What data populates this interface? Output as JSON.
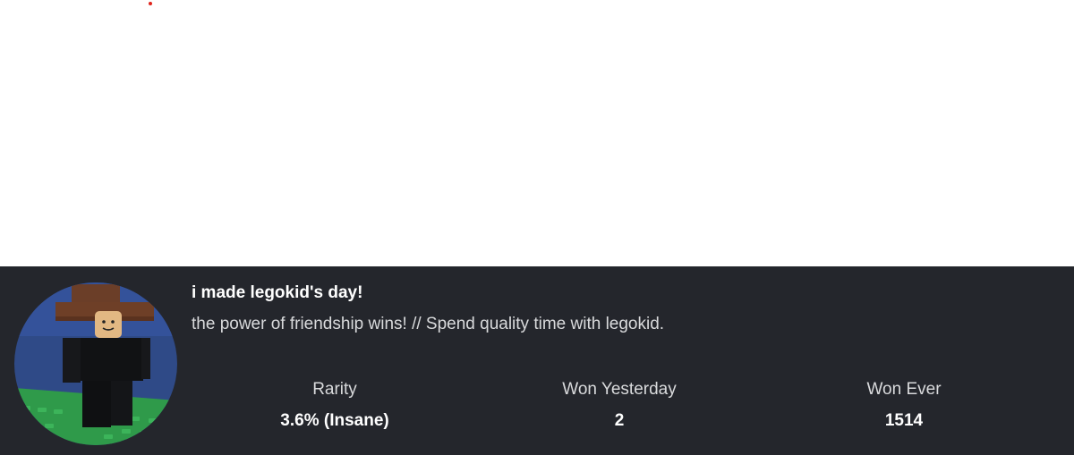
{
  "badge": {
    "title": "i made legokid's day!",
    "description": "the power of friendship wins! // Spend quality time with legokid."
  },
  "stats": {
    "rarity": {
      "label": "Rarity",
      "value": "3.6% (Insane)"
    },
    "won_yesterday": {
      "label": "Won Yesterday",
      "value": "2"
    },
    "won_ever": {
      "label": "Won Ever",
      "value": "1514"
    }
  },
  "colors": {
    "panel_background": "#24262c",
    "page_background": "#ffffff",
    "accent_dot": "#e0241b",
    "text_primary": "#ffffff",
    "text_secondary": "#d9dadc"
  },
  "icons": {
    "badge_image": "legokid-avatar-badge-image"
  }
}
